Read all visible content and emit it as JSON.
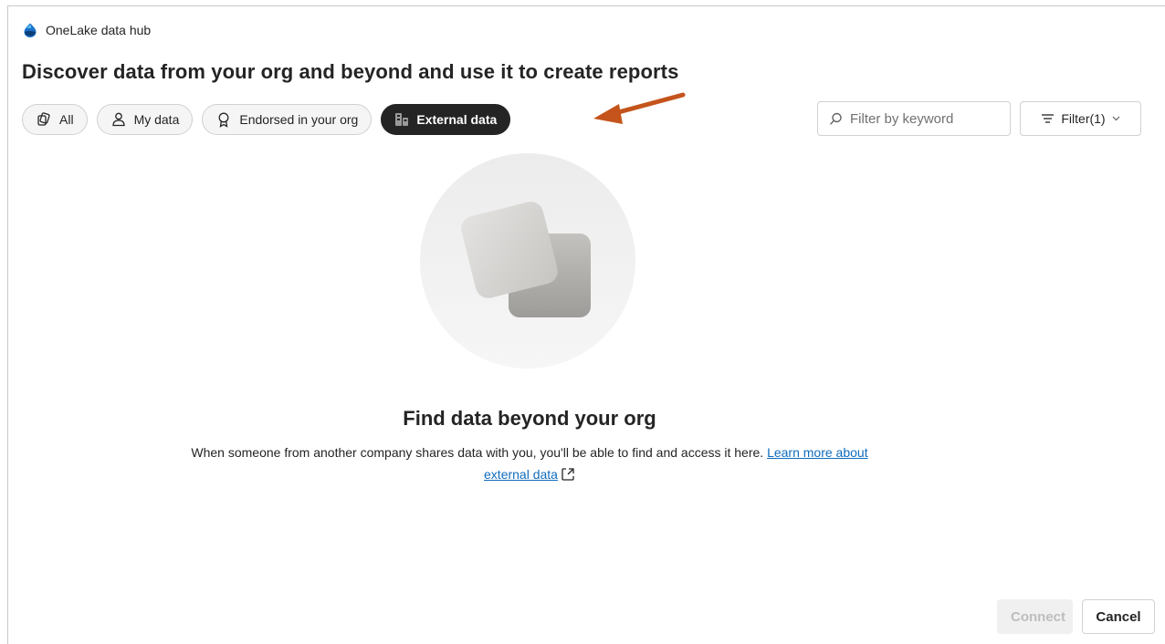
{
  "app": {
    "name": "OneLake data hub",
    "logo_icon": "onelake-logo-icon"
  },
  "page": {
    "title": "Discover data from your org and beyond and use it to create reports"
  },
  "filters": {
    "pills": [
      {
        "label": "All",
        "icon": "all-items-icon",
        "active": false
      },
      {
        "label": "My data",
        "icon": "person-icon",
        "active": false
      },
      {
        "label": "Endorsed in your org",
        "icon": "ribbon-icon",
        "active": false
      },
      {
        "label": "External data",
        "icon": "external-data-icon",
        "active": true
      }
    ],
    "search_placeholder": "Filter by keyword",
    "filter_button_label": "Filter(1)"
  },
  "empty_state": {
    "title": "Find data beyond your org",
    "description": "When someone from another company shares data with you, you'll be able to find and access it here.",
    "link_label": "Learn more about external data"
  },
  "footer": {
    "connect_label": "Connect",
    "cancel_label": "Cancel"
  },
  "colors": {
    "accent": "#0f6cbd",
    "active_pill": "#242424",
    "annotation_arrow": "#c4541b"
  }
}
